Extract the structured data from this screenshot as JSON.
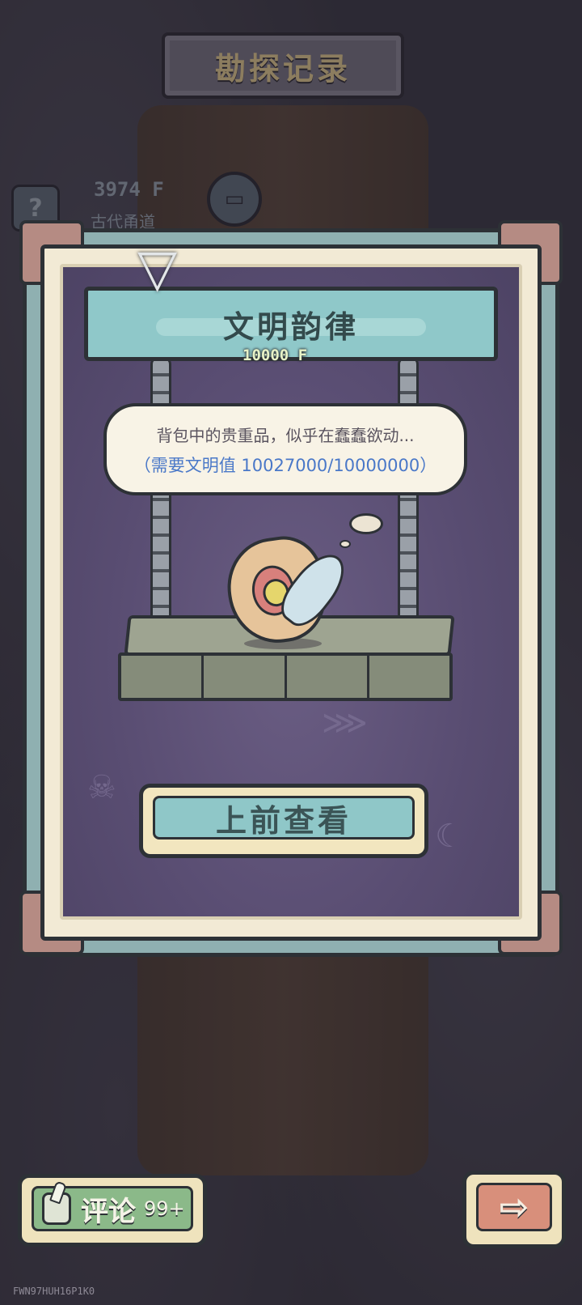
{
  "header": {
    "title": "勘探记录",
    "help_label": "?",
    "depth_value": "3974 F",
    "depth_name": "古代甬道"
  },
  "panel": {
    "title": "文明韵律",
    "depth_tag": "10000 F",
    "message": "背包中的贵重品，似乎在蠢蠢欲动...",
    "requirement": "（需要文明值  10027000/10000000）",
    "action_label": "上前查看"
  },
  "footer": {
    "comment_label": "评论",
    "comment_count": "99+",
    "next_icon": "arrow-right-icon",
    "next_glyph": "⇨"
  },
  "watermark": "FWN97HUH16P1K0",
  "colors": {
    "panel_teal": "#8fc8c9",
    "panel_purple": "#594d72",
    "requirement_blue": "#4a78c8",
    "comment_green": "#8bb989",
    "next_orange": "#d88f7b"
  }
}
